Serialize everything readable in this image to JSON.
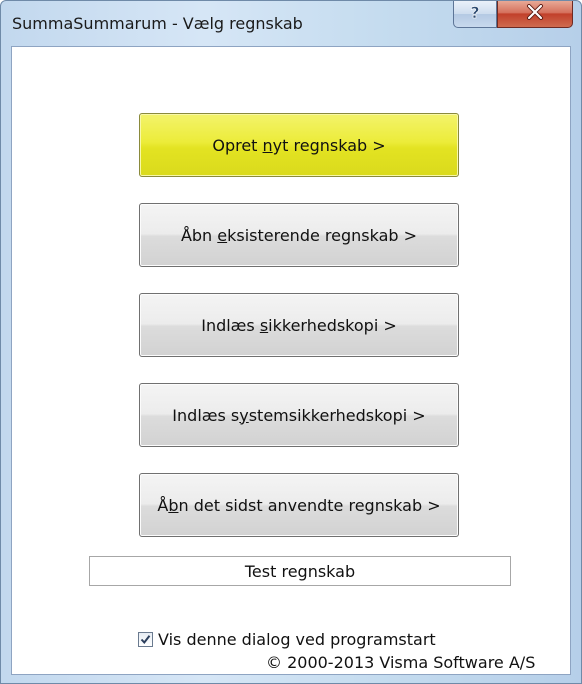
{
  "window": {
    "title": "SummaSummarum - Vælg regnskab"
  },
  "titlebar_buttons": [
    {
      "name": "help",
      "icon": "question-mark-icon"
    },
    {
      "name": "close",
      "icon": "close-x-icon"
    }
  ],
  "buttons": {
    "new_account": {
      "before": "Opret ",
      "mnemonic": "n",
      "after": "yt regnskab >"
    },
    "open_existing": {
      "before": "Åbn ",
      "mnemonic": "e",
      "after": "ksisterende regnskab >"
    },
    "load_backup": {
      "before": "Indlæs ",
      "mnemonic": "s",
      "after": "ikkerhedskopi >"
    },
    "load_system_backup": {
      "before": "Indlæs s",
      "mnemonic": "y",
      "after": "stemsikkerhedskopi >"
    },
    "open_last_used": {
      "before": "Å",
      "mnemonic": "b",
      "after": "n det sidst anvendte regnskab >"
    }
  },
  "selected_account_label": "Test regnskab",
  "startup_checkbox": {
    "label": "Vis denne dialog ved programstart",
    "checked": true
  },
  "copyright": "© 2000-2013 Visma Software A/S",
  "colors": {
    "primary_button": "#ecec3a",
    "close_button": "#c1402b",
    "titlebar": "#c5dcef"
  }
}
